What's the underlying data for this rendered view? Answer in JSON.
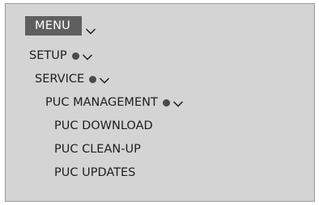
{
  "menu": {
    "title": "MENU"
  },
  "tree": {
    "setup": "SETUP",
    "service": "SERVICE",
    "puc_management": "PUC MANAGEMENT",
    "puc_download": "PUC DOWNLOAD",
    "puc_cleanup": "PUC CLEAN-UP",
    "puc_updates": "PUC UPDATES"
  },
  "icons": {
    "expand": "chevron-down-icon",
    "selected": "dot-icon"
  },
  "colors": {
    "panel_background": "#d4d4d4",
    "menu_button_background": "#5f5f5f",
    "menu_button_text": "#ffffff",
    "text": "#1e1e1e",
    "dot": "#4a4a4a"
  }
}
